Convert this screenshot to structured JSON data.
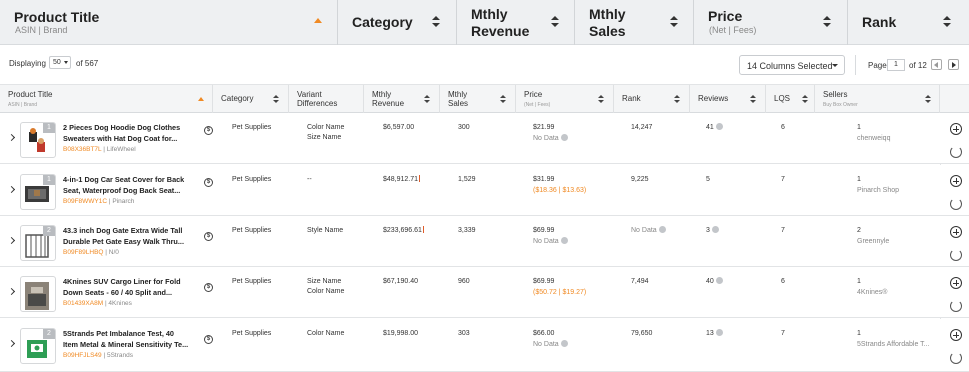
{
  "header": {
    "product_title": "Product Title",
    "product_sub": "ASIN | Brand",
    "category": "Category",
    "revenue_line1": "Mthly",
    "revenue_line2": "Revenue",
    "sales_line1": "Mthly",
    "sales_line2": "Sales",
    "price": "Price",
    "price_sub": "(Net | Fees)",
    "rank": "Rank"
  },
  "toolbar": {
    "displaying_label": "Displaying",
    "page_size": "50",
    "of_label": "of 567",
    "columns_selected": "14 Columns Selected",
    "page_label": "Page",
    "page_current": "1",
    "page_total": "of 12"
  },
  "columns": {
    "product_title": "Product Title",
    "product_sub": "ASIN | Brand",
    "category": "Category",
    "variant_line1": "Variant",
    "variant_line2": "Differences",
    "revenue_line1": "Mthly",
    "revenue_line2": "Revenue",
    "sales_line1": "Mthly",
    "sales_line2": "Sales",
    "price": "Price",
    "price_sub": "(Net | Fees)",
    "rank": "Rank",
    "reviews": "Reviews",
    "lqs": "LQS",
    "sellers": "Sellers",
    "sellers_sub": "Buy Box Owner"
  },
  "rows": [
    {
      "badge": "1",
      "title_line1": "2 Pieces Dog Hoodie Dog Clothes",
      "title_line2": "Sweaters with Hat Dog Coat for...",
      "asin": "B08X36BT7L",
      "brand": "| LifeWheel",
      "category": "Pet Supplies",
      "variant1": "Color Name",
      "variant2": "Size Name",
      "revenue": "$6,597.00",
      "sales": "300",
      "price": "$21.99",
      "price_sub": "No Data",
      "rank": "14,247",
      "reviews": "41",
      "lqs": "6",
      "sellers": "1",
      "seller_name": "chenweiqq"
    },
    {
      "badge": "1",
      "title_line1": "4-in-1 Dog Car Seat Cover for Back",
      "title_line2": "Seat, Waterproof Dog Back Seat...",
      "asin": "B09F8WWY1C",
      "brand": "| Pinarch",
      "category": "Pet Supplies",
      "variant1": "--",
      "variant2": "",
      "revenue": "$48,912.71",
      "sales": "1,529",
      "price": "$31.99",
      "price_sub": "($18.36 | $13.63)",
      "rank": "9,225",
      "reviews": "5",
      "lqs": "7",
      "sellers": "1",
      "seller_name": "Pinarch Shop"
    },
    {
      "badge": "2",
      "title_line1": "43.3 inch Dog Gate Extra Wide Tall",
      "title_line2": "Durable Pet Gate Easy Walk Thru...",
      "asin": "B09F89LHBQ",
      "brand": "| N/0",
      "category": "Pet Supplies",
      "variant1": "Style Name",
      "variant2": "",
      "revenue": "$233,696.61",
      "sales": "3,339",
      "price": "$69.99",
      "price_sub": "No Data",
      "rank": "No Data",
      "reviews": "3",
      "lqs": "7",
      "sellers": "2",
      "seller_name": "Greennyle"
    },
    {
      "badge": "",
      "title_line1": "4Knines SUV Cargo Liner for Fold",
      "title_line2": "Down Seats - 60 / 40 Split and...",
      "asin": "B01439XA8M",
      "brand": "| 4Knines",
      "category": "Pet Supplies",
      "variant1": "Size Name",
      "variant2": "Color Name",
      "revenue": "$67,190.40",
      "sales": "960",
      "price": "$69.99",
      "price_sub": "($50.72 | $19.27)",
      "rank": "7,494",
      "reviews": "40",
      "lqs": "6",
      "sellers": "1",
      "seller_name": "4Knines®"
    },
    {
      "badge": "2",
      "title_line1": "5Strands Pet Imbalance Test, 40",
      "title_line2": "Item Metal & Mineral Sensitivity Te...",
      "asin": "B09HFJLS49",
      "brand": "| 5Strands",
      "category": "Pet Supplies",
      "variant1": "Color Name",
      "variant2": "",
      "revenue": "$19,998.00",
      "sales": "303",
      "price": "$66.00",
      "price_sub": "No Data",
      "rank": "79,650",
      "reviews": "13",
      "lqs": "7",
      "sellers": "1",
      "seller_name": "5Strands Affordable T..."
    }
  ],
  "colors": {
    "accent_orange": "#f08a24",
    "header_bg": "#eef0f2",
    "muted_text": "#888888"
  },
  "icons": {
    "sort": "sort-icon",
    "chevron": "chevron-right-icon",
    "dollar": "dollar-circle-icon",
    "info": "info-icon",
    "add": "plus-circle-icon",
    "refresh": "refresh-icon"
  }
}
